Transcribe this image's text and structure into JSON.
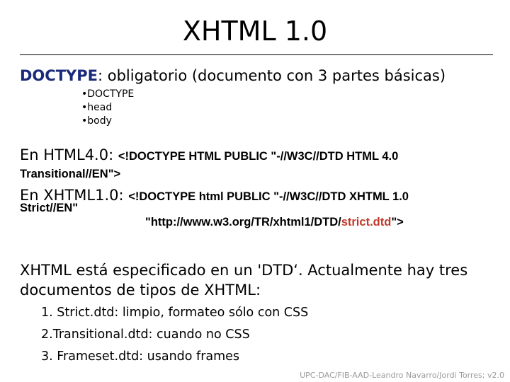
{
  "title": "XHTML 1.0",
  "doctype_line": {
    "keyword": "DOCTYPE",
    "rest": ": obligatorio (documento con 3 partes básicas)"
  },
  "parts": [
    "DOCTYPE",
    "head",
    "body"
  ],
  "html40": {
    "prefix": "En HTML4.0: ",
    "code_line1": "<!DOCTYPE HTML PUBLIC \"-//W3C//DTD HTML 4.0",
    "code_line2": "Transitional//EN\">"
  },
  "xhtml10": {
    "prefix": "En XHTML1.0: ",
    "code_line1": "<!DOCTYPE html PUBLIC \"-//W3C//DTD XHTML 1.0",
    "code_line2": "Strict//EN\"",
    "url_before": "\"http://www.w3.org/TR/xhtml1/DTD/",
    "url_highlight": "strict.dtd",
    "url_after": "\">"
  },
  "paragraph": {
    "line1": "XHTML está especificado en un 'DTD‘. Actualmente hay tres",
    "line2": "documentos de tipos de XHTML:"
  },
  "dtd_list": [
    "1. Strict.dtd: limpio, formateo sólo con CSS",
    "2.Transitional.dtd: cuando no CSS",
    "3. Frameset.dtd: usando frames"
  ],
  "footer": "UPC-DAC/FIB-AAD-Leandro Navarro/Jordi Torres; v2.0",
  "colors": {
    "keyword_blue": "#1a2a7a",
    "highlight_red": "#c0392b",
    "footer_gray": "#9a9a9a"
  }
}
